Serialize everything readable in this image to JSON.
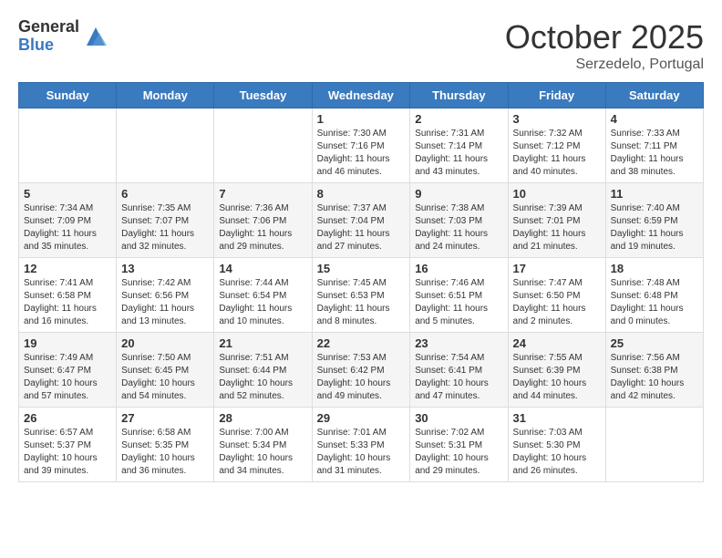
{
  "header": {
    "logo_general": "General",
    "logo_blue": "Blue",
    "month_title": "October 2025",
    "location": "Serzedelo, Portugal"
  },
  "weekdays": [
    "Sunday",
    "Monday",
    "Tuesday",
    "Wednesday",
    "Thursday",
    "Friday",
    "Saturday"
  ],
  "weeks": [
    [
      {
        "day": "",
        "info": ""
      },
      {
        "day": "",
        "info": ""
      },
      {
        "day": "",
        "info": ""
      },
      {
        "day": "1",
        "info": "Sunrise: 7:30 AM\nSunset: 7:16 PM\nDaylight: 11 hours and 46 minutes."
      },
      {
        "day": "2",
        "info": "Sunrise: 7:31 AM\nSunset: 7:14 PM\nDaylight: 11 hours and 43 minutes."
      },
      {
        "day": "3",
        "info": "Sunrise: 7:32 AM\nSunset: 7:12 PM\nDaylight: 11 hours and 40 minutes."
      },
      {
        "day": "4",
        "info": "Sunrise: 7:33 AM\nSunset: 7:11 PM\nDaylight: 11 hours and 38 minutes."
      }
    ],
    [
      {
        "day": "5",
        "info": "Sunrise: 7:34 AM\nSunset: 7:09 PM\nDaylight: 11 hours and 35 minutes."
      },
      {
        "day": "6",
        "info": "Sunrise: 7:35 AM\nSunset: 7:07 PM\nDaylight: 11 hours and 32 minutes."
      },
      {
        "day": "7",
        "info": "Sunrise: 7:36 AM\nSunset: 7:06 PM\nDaylight: 11 hours and 29 minutes."
      },
      {
        "day": "8",
        "info": "Sunrise: 7:37 AM\nSunset: 7:04 PM\nDaylight: 11 hours and 27 minutes."
      },
      {
        "day": "9",
        "info": "Sunrise: 7:38 AM\nSunset: 7:03 PM\nDaylight: 11 hours and 24 minutes."
      },
      {
        "day": "10",
        "info": "Sunrise: 7:39 AM\nSunset: 7:01 PM\nDaylight: 11 hours and 21 minutes."
      },
      {
        "day": "11",
        "info": "Sunrise: 7:40 AM\nSunset: 6:59 PM\nDaylight: 11 hours and 19 minutes."
      }
    ],
    [
      {
        "day": "12",
        "info": "Sunrise: 7:41 AM\nSunset: 6:58 PM\nDaylight: 11 hours and 16 minutes."
      },
      {
        "day": "13",
        "info": "Sunrise: 7:42 AM\nSunset: 6:56 PM\nDaylight: 11 hours and 13 minutes."
      },
      {
        "day": "14",
        "info": "Sunrise: 7:44 AM\nSunset: 6:54 PM\nDaylight: 11 hours and 10 minutes."
      },
      {
        "day": "15",
        "info": "Sunrise: 7:45 AM\nSunset: 6:53 PM\nDaylight: 11 hours and 8 minutes."
      },
      {
        "day": "16",
        "info": "Sunrise: 7:46 AM\nSunset: 6:51 PM\nDaylight: 11 hours and 5 minutes."
      },
      {
        "day": "17",
        "info": "Sunrise: 7:47 AM\nSunset: 6:50 PM\nDaylight: 11 hours and 2 minutes."
      },
      {
        "day": "18",
        "info": "Sunrise: 7:48 AM\nSunset: 6:48 PM\nDaylight: 11 hours and 0 minutes."
      }
    ],
    [
      {
        "day": "19",
        "info": "Sunrise: 7:49 AM\nSunset: 6:47 PM\nDaylight: 10 hours and 57 minutes."
      },
      {
        "day": "20",
        "info": "Sunrise: 7:50 AM\nSunset: 6:45 PM\nDaylight: 10 hours and 54 minutes."
      },
      {
        "day": "21",
        "info": "Sunrise: 7:51 AM\nSunset: 6:44 PM\nDaylight: 10 hours and 52 minutes."
      },
      {
        "day": "22",
        "info": "Sunrise: 7:53 AM\nSunset: 6:42 PM\nDaylight: 10 hours and 49 minutes."
      },
      {
        "day": "23",
        "info": "Sunrise: 7:54 AM\nSunset: 6:41 PM\nDaylight: 10 hours and 47 minutes."
      },
      {
        "day": "24",
        "info": "Sunrise: 7:55 AM\nSunset: 6:39 PM\nDaylight: 10 hours and 44 minutes."
      },
      {
        "day": "25",
        "info": "Sunrise: 7:56 AM\nSunset: 6:38 PM\nDaylight: 10 hours and 42 minutes."
      }
    ],
    [
      {
        "day": "26",
        "info": "Sunrise: 6:57 AM\nSunset: 5:37 PM\nDaylight: 10 hours and 39 minutes."
      },
      {
        "day": "27",
        "info": "Sunrise: 6:58 AM\nSunset: 5:35 PM\nDaylight: 10 hours and 36 minutes."
      },
      {
        "day": "28",
        "info": "Sunrise: 7:00 AM\nSunset: 5:34 PM\nDaylight: 10 hours and 34 minutes."
      },
      {
        "day": "29",
        "info": "Sunrise: 7:01 AM\nSunset: 5:33 PM\nDaylight: 10 hours and 31 minutes."
      },
      {
        "day": "30",
        "info": "Sunrise: 7:02 AM\nSunset: 5:31 PM\nDaylight: 10 hours and 29 minutes."
      },
      {
        "day": "31",
        "info": "Sunrise: 7:03 AM\nSunset: 5:30 PM\nDaylight: 10 hours and 26 minutes."
      },
      {
        "day": "",
        "info": ""
      }
    ]
  ]
}
